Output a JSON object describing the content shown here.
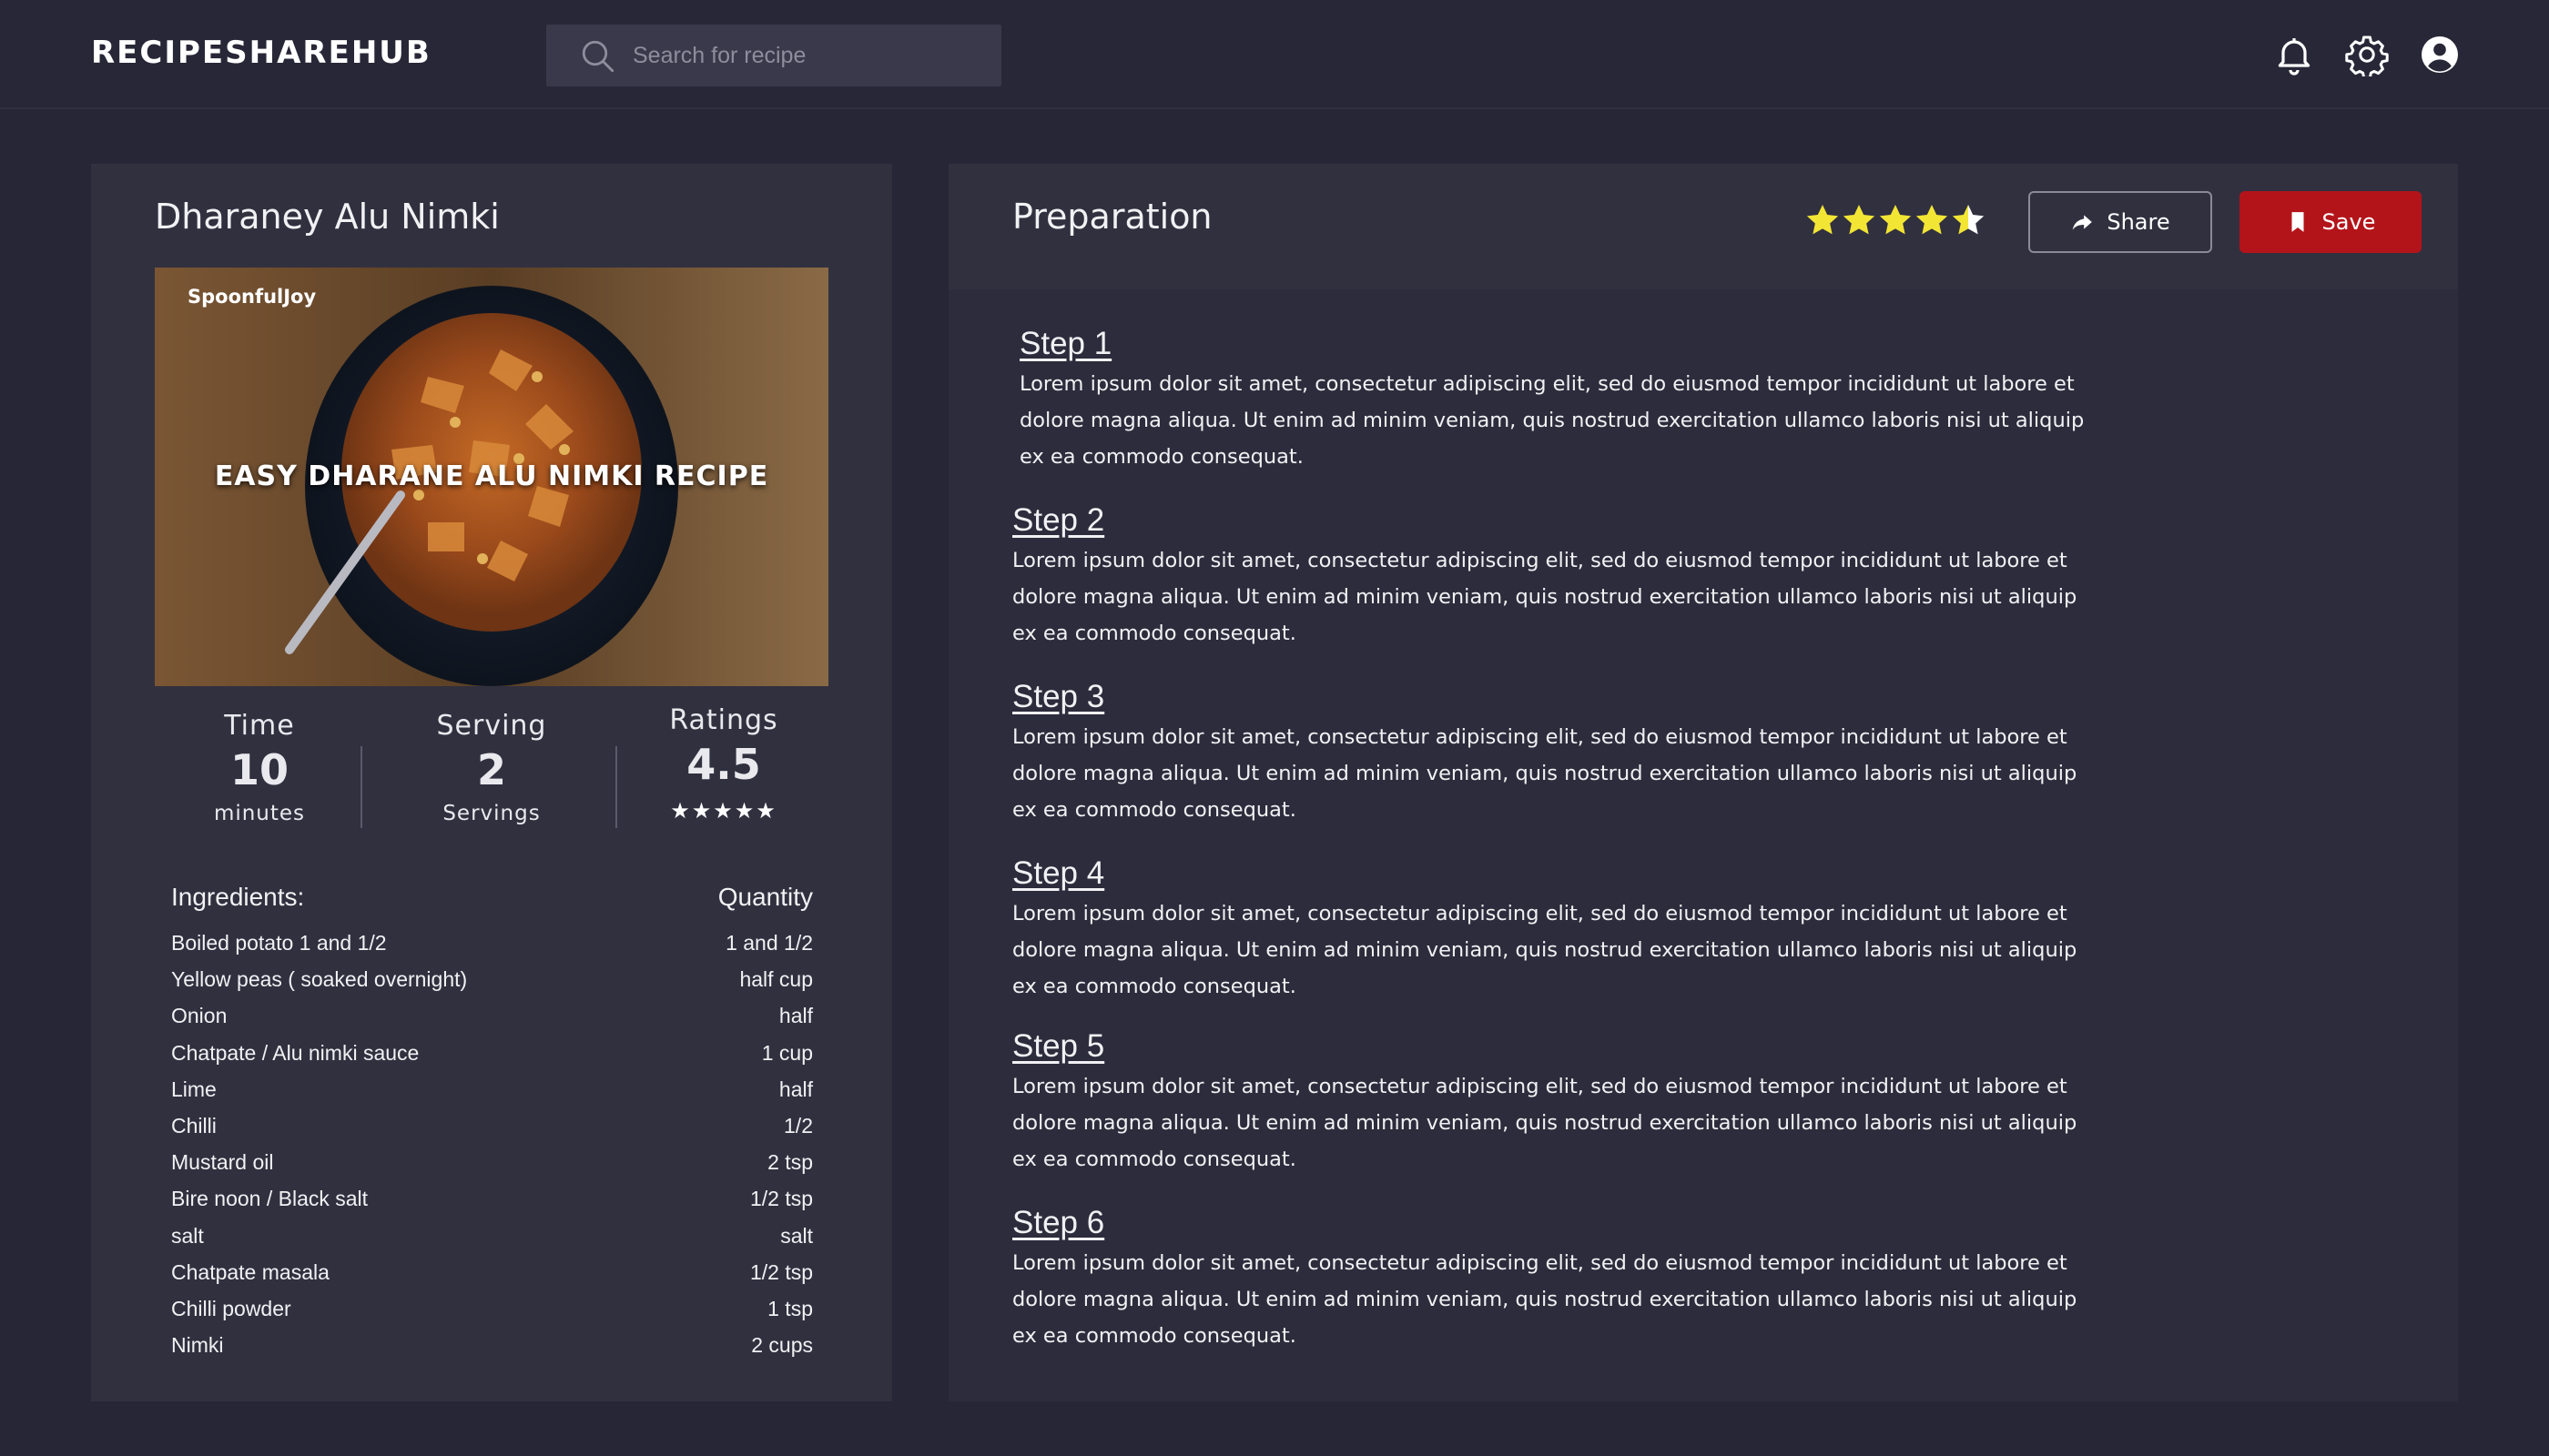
{
  "app": {
    "name": "RECIPESHAREHUB"
  },
  "search": {
    "placeholder": "Search for recipe"
  },
  "header_icons": [
    "bell-icon",
    "gear-icon",
    "user-circle-icon"
  ],
  "recipe": {
    "title": "Dharaney Alu Nimki",
    "image": {
      "brand": "SpoonfulJoy",
      "caption": "EASY DHARANE ALU NIMKI RECIPE"
    },
    "stats": {
      "time": {
        "label": "Time",
        "value": "10",
        "unit": "minutes"
      },
      "serving": {
        "label": "Serving",
        "value": "2",
        "unit": "Servings"
      },
      "ratings": {
        "label": "Ratings",
        "value": "4.5",
        "stars": "★★★★★"
      }
    }
  },
  "ingredients": {
    "header": "Ingredients:",
    "qty_header": "Quantity",
    "items": [
      {
        "name": "Boiled potato 1 and 1/2",
        "qty": "1 and 1/2"
      },
      {
        "name": "Yellow peas ( soaked overnight)",
        "qty": "half cup"
      },
      {
        "name": "Onion",
        "qty": "half"
      },
      {
        "name": "Chatpate / Alu nimki sauce",
        "qty": "1 cup"
      },
      {
        "name": "Lime",
        "qty": "half"
      },
      {
        "name": "Chilli",
        "qty": "1/2 "
      },
      {
        "name": "Mustard oil",
        "qty": "2 tsp"
      },
      {
        "name": "Bire noon / Black salt",
        "qty": "1/2 tsp"
      },
      {
        "name": "salt",
        "qty": "salt"
      },
      {
        "name": "Chatpate masala",
        "qty": "1/2 tsp"
      },
      {
        "name": "Chilli powder",
        "qty": "1 tsp"
      },
      {
        "name": "Nimki",
        "qty": "2 cups"
      }
    ]
  },
  "preparation": {
    "title": "Preparation",
    "rating": 4.5,
    "share_label": "Share",
    "save_label": "Save",
    "steps": [
      {
        "title": "Step 1",
        "text": "Lorem ipsum dolor sit amet, consectetur adipiscing elit, sed do eiusmod tempor incididunt ut labore et dolore magna aliqua. Ut enim ad minim veniam, quis nostrud exercitation ullamco laboris nisi ut aliquip ex ea commodo consequat."
      },
      {
        "title": "Step 2",
        "text": "Lorem ipsum dolor sit amet, consectetur adipiscing elit, sed do eiusmod tempor incididunt ut labore et dolore magna aliqua. Ut enim ad minim veniam, quis nostrud exercitation ullamco laboris nisi ut aliquip ex ea commodo consequat."
      },
      {
        "title": "Step 3",
        "text": "Lorem ipsum dolor sit amet, consectetur adipiscing elit, sed do eiusmod tempor incididunt ut labore et dolore magna aliqua. Ut enim ad minim veniam, quis nostrud exercitation ullamco laboris nisi ut aliquip ex ea commodo consequat."
      },
      {
        "title": "Step 4",
        "text": "Lorem ipsum dolor sit amet, consectetur adipiscing elit, sed do eiusmod tempor incididunt ut labore et dolore magna aliqua. Ut enim ad minim veniam, quis nostrud exercitation ullamco laboris nisi ut aliquip ex ea commodo consequat."
      },
      {
        "title": "Step 5",
        "text": "Lorem ipsum dolor sit amet, consectetur adipiscing elit, sed do eiusmod tempor incididunt ut labore et dolore magna aliqua. Ut enim ad minim veniam, quis nostrud exercitation ullamco laboris nisi ut aliquip ex ea commodo consequat."
      },
      {
        "title": "Step 6",
        "text": "Lorem ipsum dolor sit amet, consectetur adipiscing elit, sed do eiusmod tempor incididunt ut labore et dolore magna aliqua. Ut enim ad minim veniam, quis nostrud exercitation ullamco laboris nisi ut aliquip ex ea commodo consequat."
      }
    ]
  },
  "colors": {
    "page_bg": "#272637",
    "card_bg": "#31303f",
    "star_yellow": "#f2e534",
    "save_red": "#b3141a"
  }
}
